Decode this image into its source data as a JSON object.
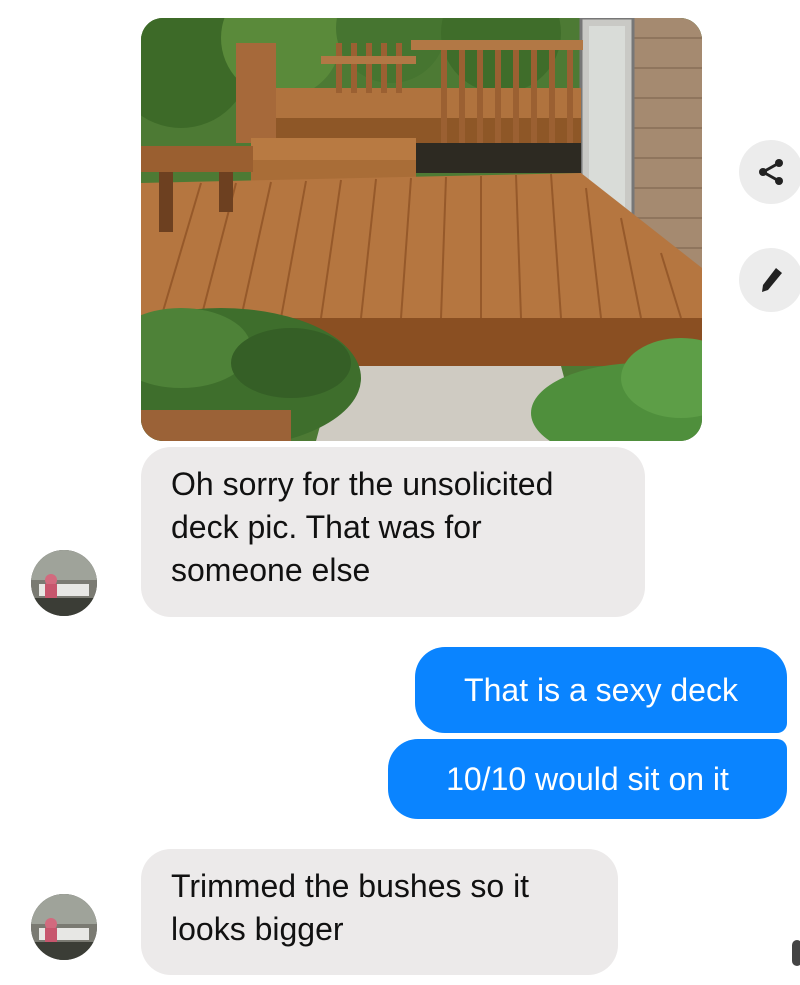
{
  "shared_photo": {
    "subject": "deck-photo"
  },
  "actions": {
    "share_icon": "share-icon",
    "edit_icon": "pencil-icon"
  },
  "messages": [
    {
      "direction": "incoming",
      "lines": [
        "Oh sorry for the unsolicited",
        "deck pic. That was for",
        "someone else"
      ]
    },
    {
      "direction": "outgoing",
      "text": "That is a sexy deck"
    },
    {
      "direction": "outgoing",
      "text": "10/10 would sit on it"
    },
    {
      "direction": "incoming",
      "lines": [
        "Trimmed the bushes so it",
        "looks bigger"
      ]
    }
  ],
  "colors": {
    "outgoing_bubble": "#0a84ff",
    "incoming_bubble": "#eceaea"
  }
}
